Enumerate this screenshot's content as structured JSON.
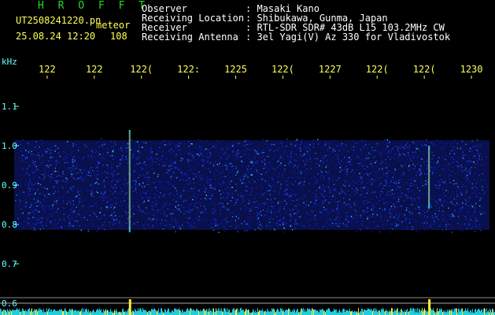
{
  "header": {
    "station": "H R O F F T",
    "filename": "UT2508241220.pn",
    "meteor_label": "meteor",
    "date_time": "25.08.24 12:20",
    "count": "108",
    "info": [
      {
        "label": "Observer",
        "value": ": Masaki Kano"
      },
      {
        "label": "Receiving Location",
        "value": ": Shibukawa, Gunma, Japan"
      },
      {
        "label": "Receiver",
        "value": ": RTL-SDR SDR# 43dB L15 103.2MHz CW"
      },
      {
        "label": "Receiving Antenna",
        "value": ": 3el Yagi(V) Az 330 for Vladivostok"
      }
    ]
  },
  "colors": {
    "background": "#000000",
    "text": "#ffffff",
    "station": "#22dd22",
    "axis_labels": "#66ffff",
    "time_labels": "#ffff55",
    "noise_band": "#1a2dd8",
    "meteor_trace": "#40e0d0"
  },
  "chart_data": {
    "type": "heatmap",
    "title": "",
    "ylabel": "kHz",
    "ylim": [
      0.58,
      1.22
    ],
    "y_ticks": [
      "1.1",
      "1.0",
      "0.9",
      "0.8",
      "0.7",
      "0.6"
    ],
    "y_tick_values": [
      1.1,
      1.0,
      0.9,
      0.8,
      0.7,
      0.6
    ],
    "x_ticks": [
      "122",
      "122",
      "122(",
      "122:",
      "1225",
      "122(",
      "1227",
      "122(",
      "122(",
      "1230"
    ],
    "x_tick_minutes": [
      1,
      2,
      3,
      4,
      5,
      6,
      7,
      8,
      9,
      10
    ],
    "xlim_minutes": [
      0,
      10.5
    ],
    "noise_band_khz": [
      0.78,
      1.02
    ],
    "meteor_events": [
      {
        "minute": 2.75,
        "khz_low": 0.78,
        "khz_high": 1.04
      },
      {
        "minute": 9.1,
        "khz_low": 0.84,
        "khz_high": 1.0
      }
    ],
    "grid": false
  }
}
